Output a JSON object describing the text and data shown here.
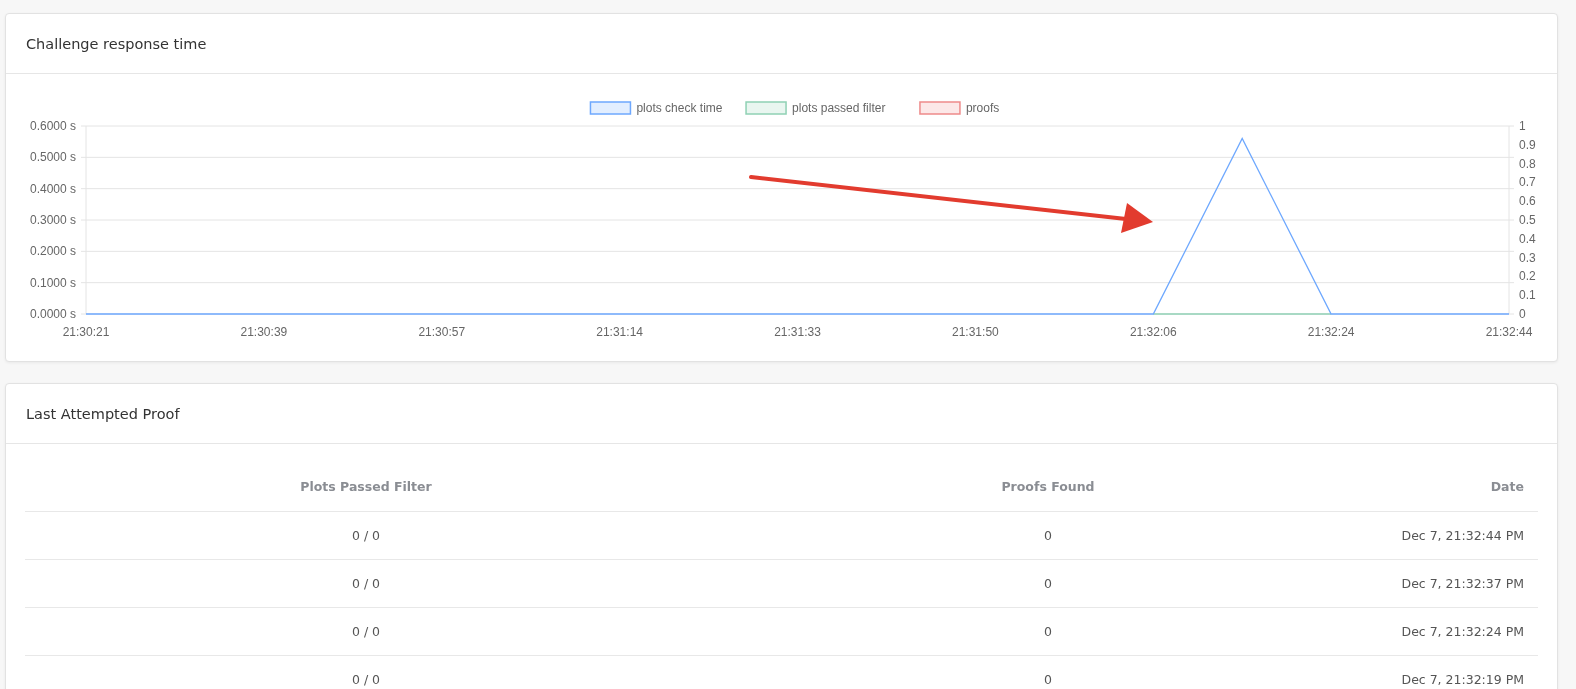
{
  "challenge_chart": {
    "title": "Challenge response time",
    "chart_data": {
      "type": "line",
      "grid": true,
      "legend": true,
      "categories": [
        "21:30:21",
        null,
        "21:30:39",
        null,
        "21:30:57",
        null,
        "21:31:14",
        null,
        "21:31:33",
        null,
        "21:31:50",
        null,
        "21:32:06",
        null,
        "21:32:24",
        null,
        "21:32:44"
      ],
      "ylim": [
        0,
        0.6
      ],
      "yticks": [
        {
          "value": 0,
          "label": "0.0000 s"
        },
        {
          "value": 0.1,
          "label": "0.1000 s"
        },
        {
          "value": 0.2,
          "label": "0.2000 s"
        },
        {
          "value": 0.3,
          "label": "0.3000 s"
        },
        {
          "value": 0.4,
          "label": "0.4000 s"
        },
        {
          "value": 0.5,
          "label": "0.5000 s"
        },
        {
          "value": 0.6,
          "label": "0.6000 s"
        }
      ],
      "y2lim": [
        0,
        1
      ],
      "y2ticks": [
        {
          "value": 0,
          "label": "0"
        },
        {
          "value": 0.1,
          "label": "0.1"
        },
        {
          "value": 0.2,
          "label": "0.2"
        },
        {
          "value": 0.3,
          "label": "0.3"
        },
        {
          "value": 0.4,
          "label": "0.4"
        },
        {
          "value": 0.5,
          "label": "0.5"
        },
        {
          "value": 0.6,
          "label": "0.6"
        },
        {
          "value": 0.7,
          "label": "0.7"
        },
        {
          "value": 0.8,
          "label": "0.8"
        },
        {
          "value": 0.9,
          "label": "0.9"
        },
        {
          "value": 1,
          "label": "1"
        }
      ],
      "series": [
        {
          "name": "plots check time",
          "color": "#6ea8fe",
          "values": [
            0,
            0,
            0,
            0,
            0,
            0,
            0,
            0,
            0,
            0,
            0,
            0,
            0,
            0.56,
            0,
            0,
            0
          ]
        },
        {
          "name": "plots passed filter",
          "color": "#8fd1b4",
          "values": [
            null,
            null,
            null,
            null,
            null,
            null,
            null,
            null,
            null,
            null,
            null,
            null,
            0,
            0,
            0,
            null,
            null
          ]
        },
        {
          "name": "proofs",
          "color": "#ee8a8a",
          "values": [
            null,
            null,
            null,
            null,
            null,
            null,
            null,
            null,
            null,
            null,
            null,
            null,
            null,
            null,
            null,
            null,
            null
          ]
        }
      ]
    }
  },
  "last_attempted_proof": {
    "title": "Last Attempted Proof",
    "table": {
      "columns": [
        "Plots Passed Filter",
        "Proofs Found",
        "Date"
      ],
      "rows": [
        [
          "0 / 0",
          "0",
          "Dec 7, 21:32:44 PM"
        ],
        [
          "0 / 0",
          "0",
          "Dec 7, 21:32:37 PM"
        ],
        [
          "0 / 0",
          "0",
          "Dec 7, 21:32:24 PM"
        ],
        [
          "0 / 0",
          "0",
          "Dec 7, 21:32:19 PM"
        ]
      ]
    }
  }
}
